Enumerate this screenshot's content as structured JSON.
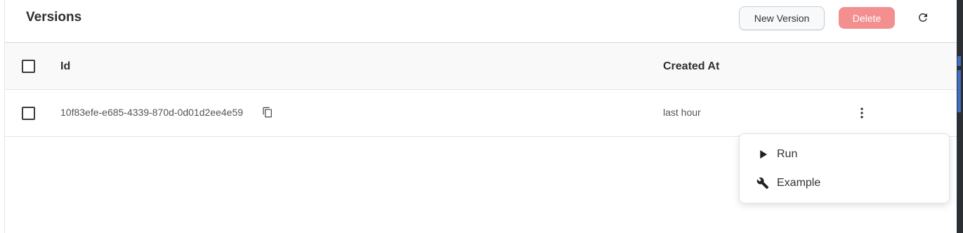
{
  "header": {
    "title": "Versions",
    "new_version_label": "New Version",
    "delete_label": "Delete"
  },
  "table": {
    "columns": [
      "Id",
      "Created At"
    ],
    "rows": [
      {
        "id": "10f83efe-e685-4339-870d-0d01d2ee4e59",
        "created_at": "last hour"
      }
    ]
  },
  "menu": {
    "items": [
      {
        "label": "Run",
        "icon": "play-icon"
      },
      {
        "label": "Example",
        "icon": "wrench-icon"
      }
    ]
  },
  "colors": {
    "delete_bg": "#f38f8f",
    "header_bg": "#f9f9f9",
    "side_panel": "#2b2f33"
  }
}
